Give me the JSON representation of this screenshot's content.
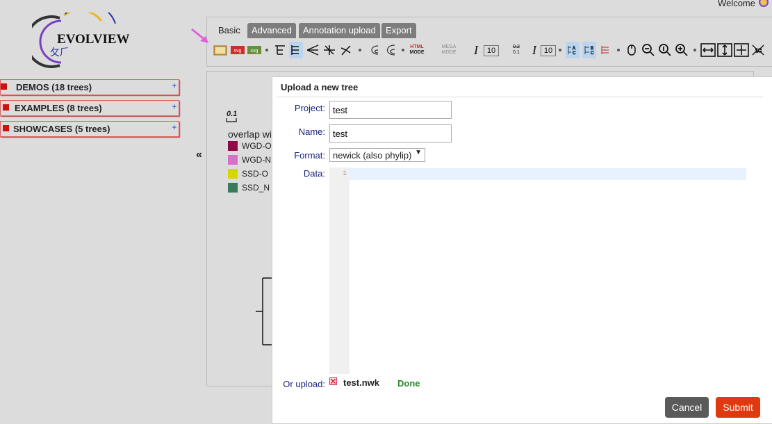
{
  "header": {
    "welcome": "Welcome"
  },
  "sidebar": {
    "logo_text": "EVOLVIEW",
    "groups": [
      {
        "label": "DEMOS (18 trees)"
      },
      {
        "label": "EXAMPLES (8 trees)"
      },
      {
        "label": "SHOWCASES (5 trees)"
      }
    ],
    "collapse_glyph": "«"
  },
  "tabs": [
    {
      "label": "Basic",
      "active": true
    },
    {
      "label": "Advanced",
      "active": false
    },
    {
      "label": "Annotation upload",
      "active": false
    },
    {
      "label": "Export",
      "active": false
    }
  ],
  "toolbar": {
    "svg_label": "svg",
    "html_mode": [
      "HTML",
      "MODE"
    ],
    "mega_mode": [
      "MEGA",
      "MODE"
    ],
    "font_size_1": "10",
    "font_size_2": "10",
    "branch_length": [
      "0.2",
      "0.1"
    ]
  },
  "canvas": {
    "scale_label": "0.1",
    "legend_title": "overlap wi",
    "legend": [
      {
        "label": "WGD-O",
        "color": "#8b0a4a"
      },
      {
        "label": "WGD-N",
        "color": "#d670c8"
      },
      {
        "label": "SSD-O",
        "color": "#d6d600"
      },
      {
        "label": "SSD_N",
        "color": "#3a7a5a"
      }
    ]
  },
  "dialog": {
    "title": "Upload a new tree",
    "project_label": "Project:",
    "project_value": "test",
    "name_label": "Name:",
    "name_value": "test",
    "format_label": "Format:",
    "format_value": "newick (also phylip)",
    "data_label": "Data:",
    "line_number": "1",
    "upload_label": "Or upload:",
    "upload_file": "test.nwk",
    "upload_status": "Done",
    "cancel_label": "Cancel",
    "submit_label": "Submit"
  }
}
